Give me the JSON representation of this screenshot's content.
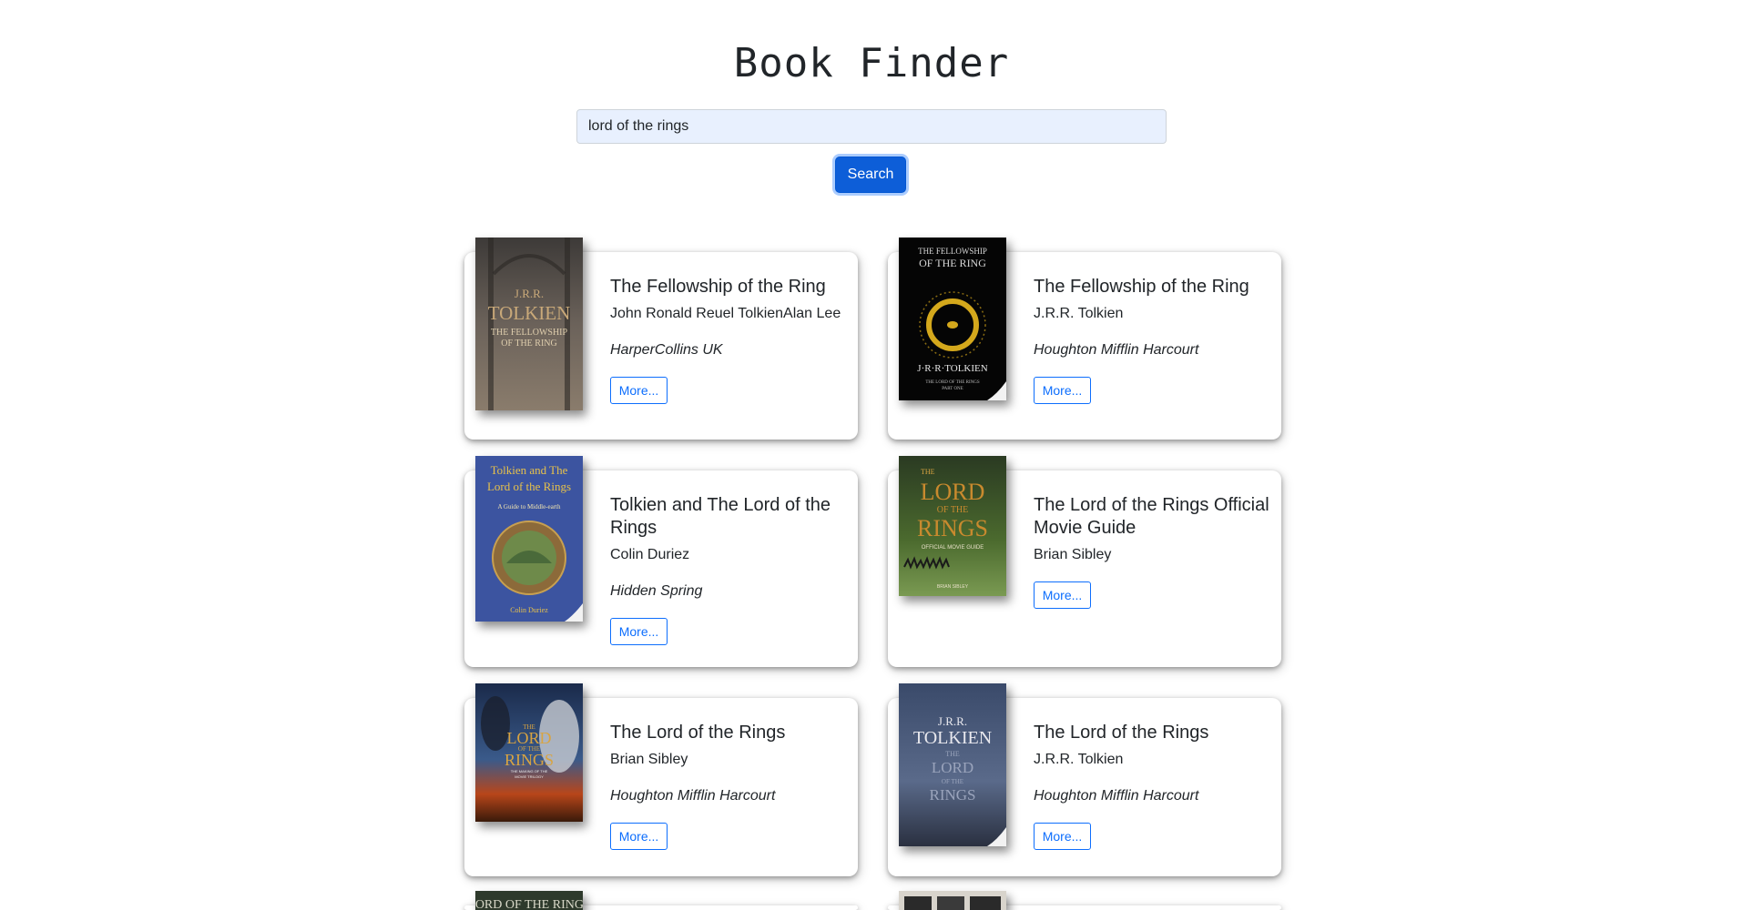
{
  "app": {
    "title": "Book Finder"
  },
  "search": {
    "value": "lord of the rings",
    "button_label": "Search"
  },
  "results": [
    {
      "title": "The Fellowship of the Ring",
      "author": "John Ronald Reuel TolkienAlan Lee",
      "publisher": "HarperCollins UK",
      "more_label": "More...",
      "cover_text": [
        "J.R.R.",
        "TOLKIEN",
        "THE FELLOWSHIP",
        "OF THE RING"
      ]
    },
    {
      "title": "The Fellowship of the Ring",
      "author": "J.R.R. Tolkien",
      "publisher": "Houghton Mifflin Harcourt",
      "more_label": "More...",
      "cover_text": [
        "THE FELLOWSHIP",
        "OF THE RING",
        "J·R·R·TOLKIEN",
        "THE LORD OF THE RINGS",
        "PART ONE"
      ]
    },
    {
      "title": "Tolkien and The Lord of the Rings",
      "author": "Colin Duriez",
      "publisher": "Hidden Spring",
      "more_label": "More...",
      "cover_text": [
        "Tolkien and The",
        "Lord of the Rings",
        "A Guide to Middle-earth",
        "Colin Duriez"
      ]
    },
    {
      "title": "The Lord of the Rings Official Movie Guide",
      "author": "Brian Sibley",
      "publisher": "",
      "more_label": "More...",
      "cover_text": [
        "THE",
        "LORD",
        "OF THE",
        "RINGS",
        "OFFICIAL MOVIE GUIDE",
        "BRIAN SIBLEY"
      ]
    },
    {
      "title": "The Lord of the Rings",
      "author": "Brian Sibley",
      "publisher": "Houghton Mifflin Harcourt",
      "more_label": "More...",
      "cover_text": [
        "THE",
        "LORD",
        "OF THE",
        "RINGS",
        "THE MAKING OF THE",
        "MOVIE TRILOGY"
      ]
    },
    {
      "title": "The Lord of the Rings",
      "author": "J.R.R. Tolkien",
      "publisher": "Houghton Mifflin Harcourt",
      "more_label": "More...",
      "cover_text": [
        "J.R.R.",
        "TOLKIEN",
        "THE",
        "LORD",
        "OF THE",
        "RINGS"
      ]
    },
    {
      "title": "",
      "author": "",
      "publisher": "",
      "more_label": "",
      "cover_text": [
        "LORD OF THE RINGS"
      ]
    },
    {
      "title": "",
      "author": "",
      "publisher": "",
      "more_label": "",
      "cover_text": []
    }
  ],
  "colors": {
    "accent": "#0d6efd",
    "button_bg": "#0d5ed8",
    "input_bg": "#e8f0fe"
  }
}
